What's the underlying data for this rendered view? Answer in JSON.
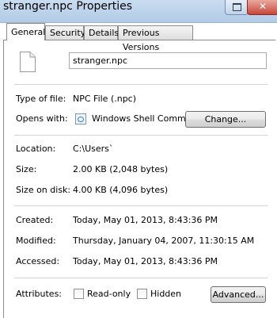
{
  "window": {
    "title": "stranger.npc Properties",
    "close_glyph": "✕"
  },
  "tabs": [
    {
      "label": "General",
      "active": true
    },
    {
      "label": "Security"
    },
    {
      "label": "Details"
    },
    {
      "label": "Previous Versions"
    }
  ],
  "file": {
    "name": "stranger.npc",
    "icon": "file-icon"
  },
  "properties": {
    "type_label": "Type of file:",
    "type_value": "NPC File (.npc)",
    "opens_label": "Opens with:",
    "opens_value": "Windows Shell Commor",
    "change_label": "Change...",
    "location_label": "Location:",
    "location_value": "C:\\Users`",
    "size_label": "Size:",
    "size_value": "2.00 KB (2,048 bytes)",
    "size_disk_label": "Size on disk:",
    "size_disk_value": "4.00 KB (4,096 bytes)",
    "created_label": "Created:",
    "created_value": "Today, May 01, 2013, 8:43:36 PM",
    "modified_label": "Modified:",
    "modified_value": "Thursday, January 04, 2007, 11:30:15 AM",
    "accessed_label": "Accessed:",
    "accessed_value": "Today, May 01, 2013, 8:43:36 PM"
  },
  "attributes": {
    "label": "Attributes:",
    "readonly_label": "Read-only",
    "readonly_checked": false,
    "hidden_label": "Hidden",
    "hidden_checked": false,
    "advanced_label": "Advanced..."
  },
  "colors": {
    "titlebar": "#b2cbe6",
    "close_button": "#c7473a"
  }
}
